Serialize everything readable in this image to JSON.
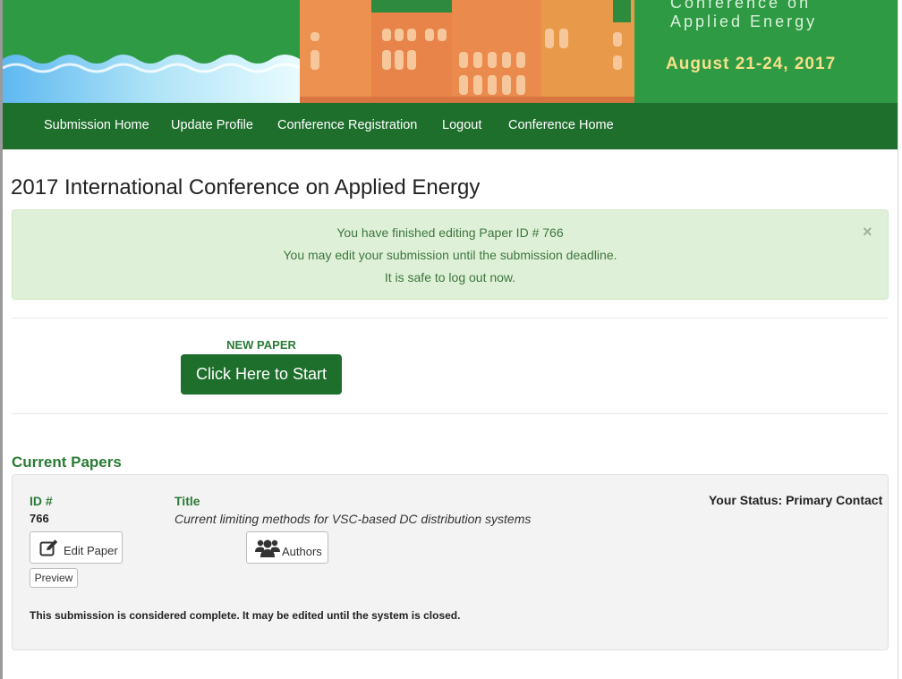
{
  "banner": {
    "subtitle_lines": "Conference on\nApplied Energy",
    "dates": "August 21-24, 2017",
    "colors": {
      "green": "#2e9a43",
      "building": "#e8834a",
      "date_text": "#f6e08a"
    }
  },
  "nav": {
    "items": [
      "Submission Home",
      "Update Profile",
      "Conference Registration",
      "Logout",
      "Conference Home"
    ],
    "background": "#1e6e2c"
  },
  "page": {
    "title": "2017 International Conference on Applied Energy"
  },
  "alert": {
    "lines": [
      "You have finished editing Paper ID # 766",
      "You may edit your submission until the submission deadline.",
      "It is safe to log out now."
    ],
    "close_glyph": "×"
  },
  "new_paper": {
    "label": "NEW PAPER",
    "button": "Click Here to Start"
  },
  "current_papers": {
    "heading": "Current Papers",
    "id_header": "ID #",
    "title_header": "Title",
    "status_label": "Your Status:",
    "status_value": "Primary Contact",
    "paper": {
      "id": "766",
      "title": "Current limiting methods for VSC-based DC distribution systems"
    },
    "buttons": {
      "edit": "Edit Paper",
      "authors": "Authors",
      "preview": "Preview"
    },
    "icons": {
      "edit": "edit-icon",
      "authors": "users-icon"
    },
    "note": "This submission is considered complete. It may be edited until the system is closed."
  }
}
